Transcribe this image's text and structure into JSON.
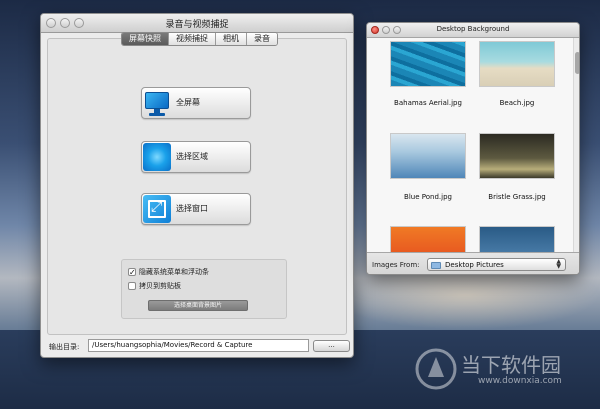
{
  "main_window": {
    "title": "录音与视频捕捉",
    "tabs": [
      {
        "label": "屏幕快照",
        "active": true
      },
      {
        "label": "视频捕捉",
        "active": false
      },
      {
        "label": "相机",
        "active": false
      },
      {
        "label": "录音",
        "active": false
      }
    ],
    "buttons": {
      "fullscreen": "全屏幕",
      "region": "选择区域",
      "window": "选择窗口"
    },
    "options": {
      "hide_menu": {
        "label": "隐藏系统菜单和浮动条",
        "checked": true
      },
      "copy_clipboard": {
        "label": "拷贝到剪贴板",
        "checked": false
      },
      "desktop_image_button": "选择桌面背景图片"
    },
    "footer": {
      "output_label": "输出目录:",
      "path_value": "/Users/huangsophia/Movies/Record & Capture",
      "browse_label": "..."
    }
  },
  "desktop_background": {
    "title": "Desktop Background",
    "images": [
      {
        "name": "Bahamas Aerial.jpg"
      },
      {
        "name": "Beach.jpg"
      },
      {
        "name": "Blue Pond.jpg"
      },
      {
        "name": "Bristle Grass.jpg"
      }
    ],
    "images_from_label": "Images From:",
    "images_from_value": "Desktop Pictures"
  },
  "watermark": {
    "text": "当下软件园",
    "url": "www.downxia.com"
  },
  "colors": {
    "accent_blue": "#0a7fd6",
    "tab_active": "#6a6a6a"
  }
}
